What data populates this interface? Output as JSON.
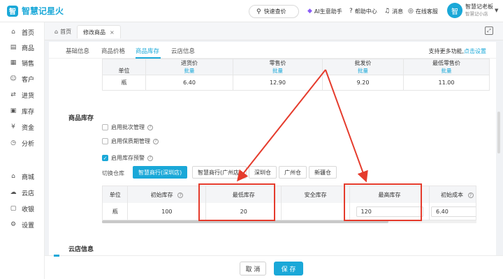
{
  "app": {
    "logo_text": "智慧记星火",
    "logo_glyph": "智",
    "accent": "#1aa8d8",
    "highlight_color": "#e53b2c"
  },
  "topbar": {
    "search_label": "快速查价",
    "nav": [
      {
        "icon": "ai-icon",
        "glyph": "◆",
        "label": "AI生意助手"
      },
      {
        "icon": "help-icon",
        "glyph": "?",
        "label": "帮助中心"
      },
      {
        "icon": "bell-icon",
        "glyph": "♫",
        "label": "消息"
      },
      {
        "icon": "headset-icon",
        "glyph": "◎",
        "label": "在线客服"
      }
    ],
    "user": {
      "name": "智慧记老板",
      "shop": "智慧记小店",
      "avatar_glyph": "智"
    }
  },
  "sidebar": {
    "items": [
      {
        "icon": "home-icon",
        "glyph": "⌂",
        "label": "首页"
      },
      {
        "icon": "product-icon",
        "glyph": "▤",
        "label": "商品"
      },
      {
        "icon": "sales-icon",
        "glyph": "▦",
        "label": "销售"
      },
      {
        "icon": "customer-icon",
        "glyph": "☺",
        "label": "客户"
      },
      {
        "icon": "purchase-icon",
        "glyph": "⇄",
        "label": "进货"
      },
      {
        "icon": "inventory-icon",
        "glyph": "▣",
        "label": "库存"
      },
      {
        "icon": "funds-icon",
        "glyph": "¥",
        "label": "资金"
      },
      {
        "icon": "analysis-icon",
        "glyph": "◷",
        "label": "分析"
      },
      {
        "icon": "mall-icon",
        "glyph": "⌂",
        "label": "商城"
      },
      {
        "icon": "cloud-store-icon",
        "glyph": "☁",
        "label": "云店"
      },
      {
        "icon": "cashier-icon",
        "glyph": "▢",
        "label": "收银"
      },
      {
        "icon": "settings-icon",
        "glyph": "⚙",
        "label": "设置"
      }
    ]
  },
  "tabs": {
    "home": "首页",
    "current": "修改商品",
    "close_glyph": "×"
  },
  "subtabs": {
    "items": [
      "基础信息",
      "商品价格",
      "商品库存",
      "云店信息"
    ],
    "active_index": 2,
    "more_text": "支持更多功能,",
    "more_link": "点击设置"
  },
  "price_table": {
    "headers": [
      {
        "title": "单位",
        "sub": ""
      },
      {
        "title": "进货价",
        "sub": "批量"
      },
      {
        "title": "零售价",
        "sub": "批量"
      },
      {
        "title": "批发价",
        "sub": "批量"
      },
      {
        "title": "最低零售价",
        "sub": "批量"
      }
    ],
    "row": [
      "瓶",
      "6.40",
      "12.90",
      "9.20",
      "11.00"
    ]
  },
  "stock_section": {
    "title": "商品库存",
    "options": [
      {
        "label": "启用批次管理",
        "checked": false
      },
      {
        "label": "启用保质期管理",
        "checked": false
      },
      {
        "label": "启用库存预警",
        "checked": true
      }
    ],
    "warehouse_label": "切换仓库",
    "warehouses": [
      "智慧商行(深圳店)",
      "智慧商行(广州店)",
      "深圳仓",
      "广州仓",
      "新疆仓"
    ],
    "active_warehouse": 0
  },
  "stock_table": {
    "headers": [
      "单位",
      "初始库存",
      "最低库存",
      "安全库存",
      "最高库存",
      "初始成本"
    ],
    "row": {
      "unit": "瓶",
      "initial_stock": "100",
      "min_stock": "20",
      "safety_stock": "",
      "max_stock": "120",
      "initial_cost": "6.40"
    }
  },
  "cloud_section": {
    "title": "云店信息"
  },
  "footer": {
    "cancel": "取 消",
    "save": "保 存"
  }
}
